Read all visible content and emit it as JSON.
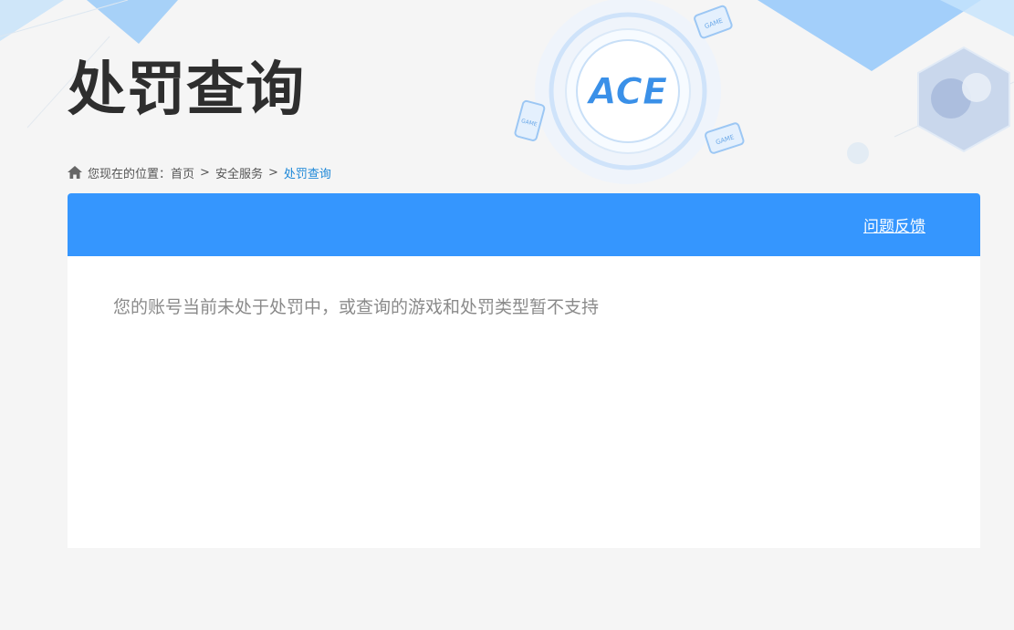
{
  "page": {
    "title": "处罚查询"
  },
  "breadcrumb": {
    "prefix": "您现在的位置：",
    "items": [
      "首页",
      "安全服务"
    ],
    "current": "处罚查询",
    "separator": ">"
  },
  "panel": {
    "feedback_link": "问题反馈",
    "message": "您的账号当前未处于处罚中，或查询的游戏和处罚类型暂不支持"
  },
  "decor": {
    "logo_text": "ACE",
    "card_label": "GAME"
  },
  "colors": {
    "accent": "#3596fe",
    "breadcrumb_current": "#1e88d8",
    "background": "#f5f5f5"
  }
}
